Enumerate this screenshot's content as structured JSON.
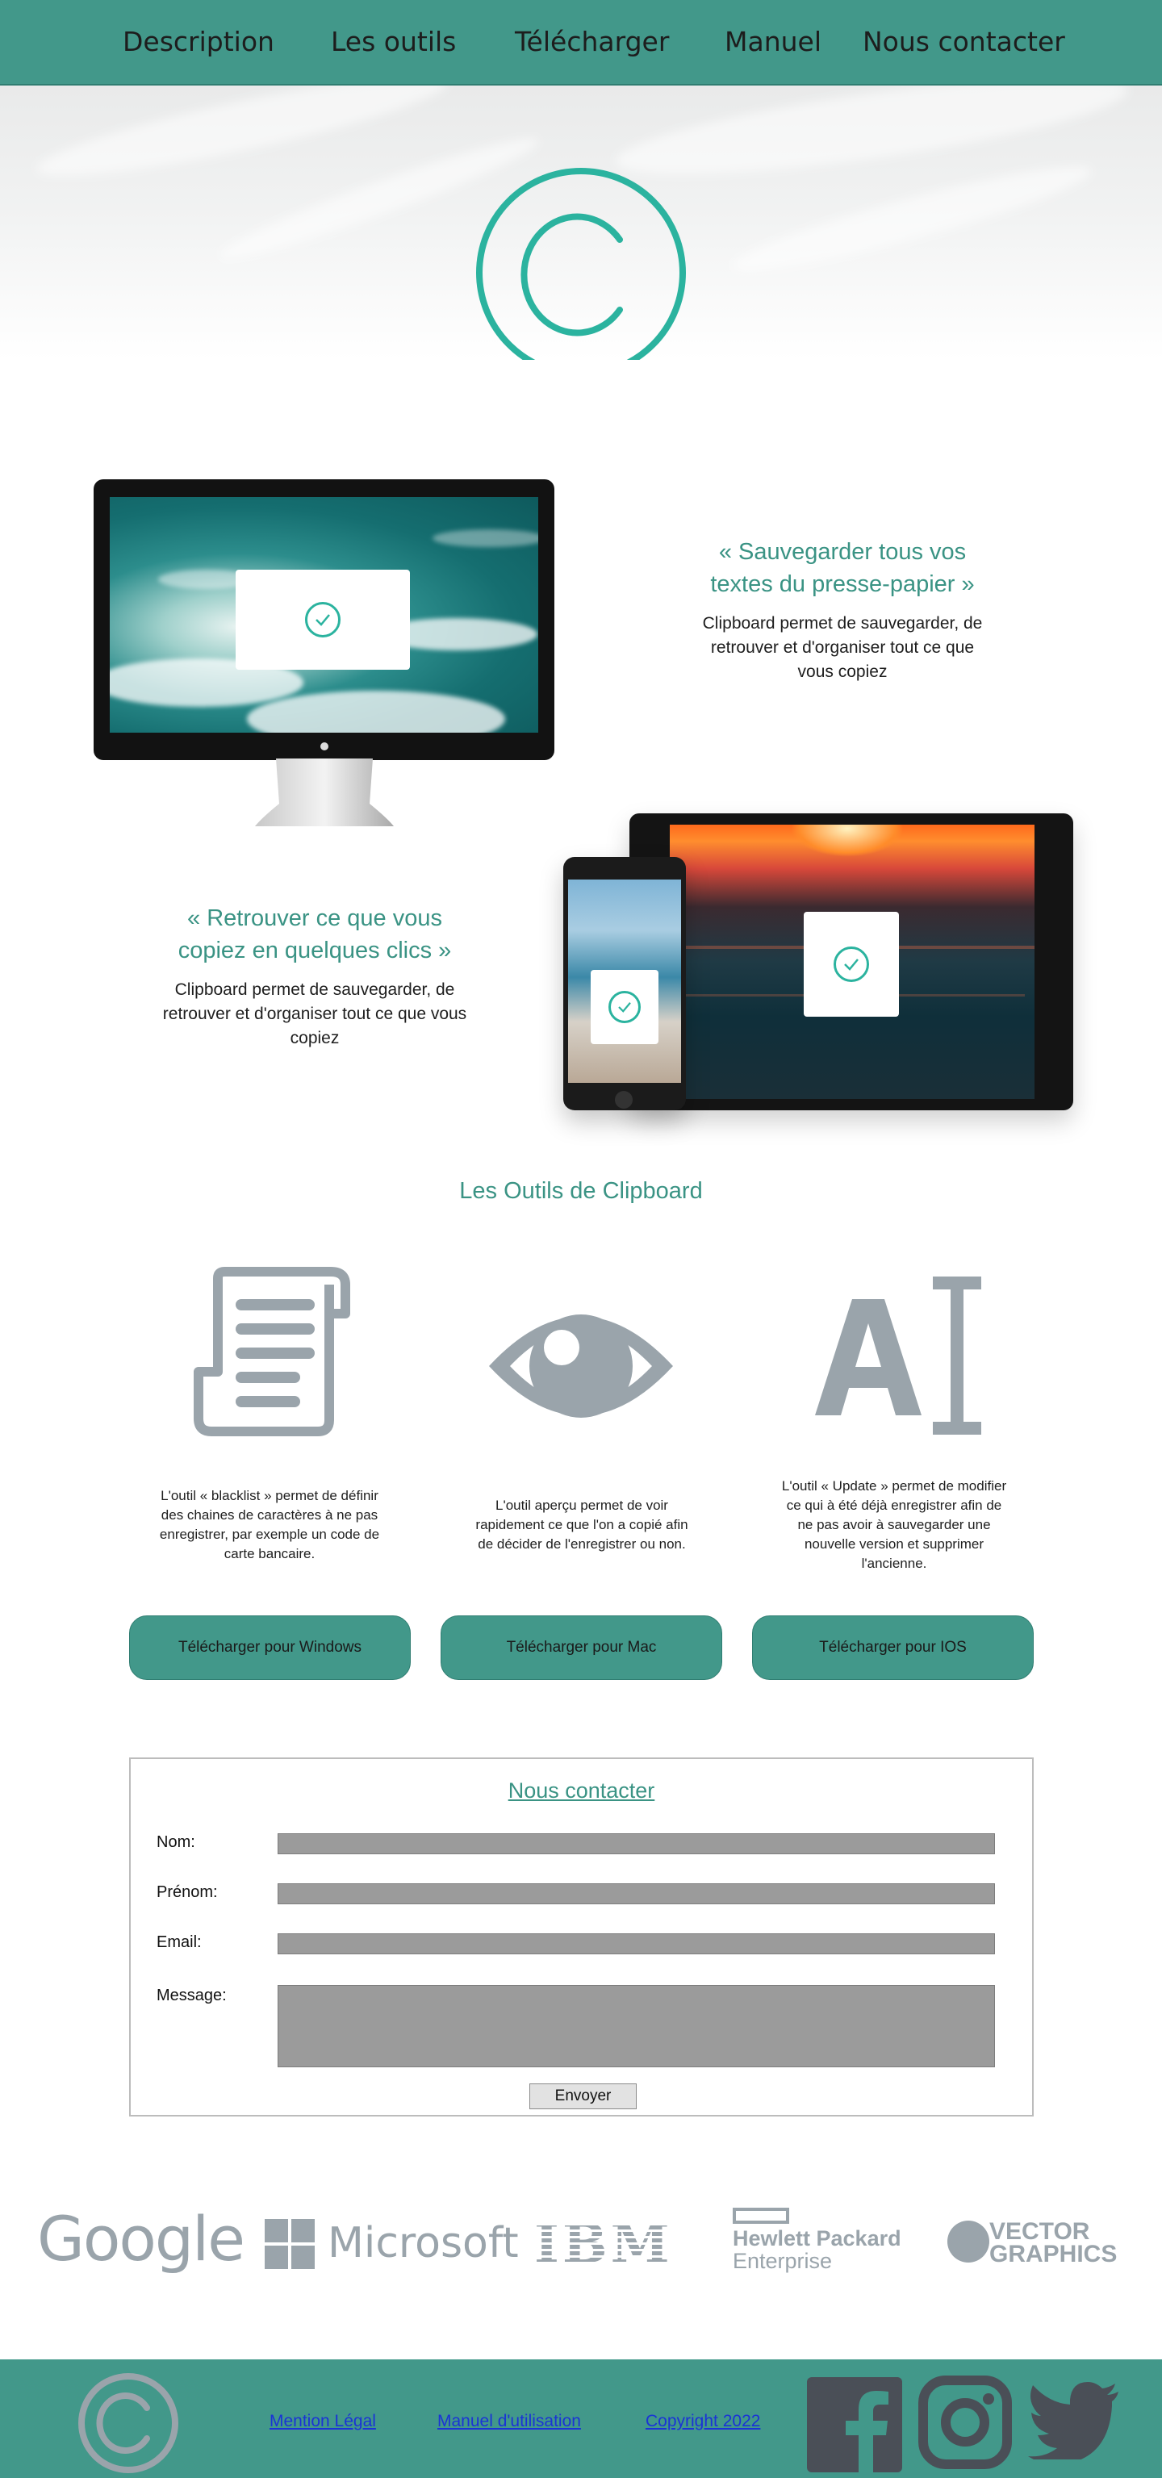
{
  "nav": {
    "items": [
      {
        "label": "Description"
      },
      {
        "label": "Les outils"
      },
      {
        "label": "Télécharger"
      },
      {
        "label": "Manuel"
      },
      {
        "label": "Nous contacter"
      }
    ]
  },
  "features": [
    {
      "title": "« Sauvegarder tous vos textes du presse-papier »",
      "text": "Clipboard permet de sauvegarder, de retrouver et d'organiser tout ce que vous copiez"
    },
    {
      "title": "« Retrouver ce que vous copiez en quelques clics »",
      "text": "Clipboard permet de sauvegarder, de retrouver et d'organiser tout ce que vous copiez"
    }
  ],
  "tools": {
    "title": "Les Outils de Clipboard",
    "items": [
      {
        "icon": "scroll-list-icon",
        "text": "L'outil « blacklist » permet de définir des chaines de caractères à ne pas enregistrer, par exemple un code de carte bancaire."
      },
      {
        "icon": "eye-icon",
        "text": "L'outil aperçu permet de voir rapidement ce que l'on a copié afin de décider de l'enregistrer ou non."
      },
      {
        "icon": "text-cursor-icon",
        "text": "L'outil « Update » permet de modifier ce qui à été déjà enregistrer afin de ne pas avoir à sauvegarder une nouvelle version et supprimer l'ancienne."
      }
    ],
    "downloads": [
      {
        "label": "Télécharger pour Windows"
      },
      {
        "label": "Télécharger pour Mac"
      },
      {
        "label": "Télécharger pour IOS"
      }
    ]
  },
  "contact": {
    "title": "Nous contacter",
    "fields": [
      {
        "label": "Nom:"
      },
      {
        "label": "Prénom:"
      },
      {
        "label": "Email:"
      },
      {
        "label": "Message:"
      }
    ],
    "submit": "Envoyer"
  },
  "partners": {
    "google": "Google",
    "microsoft": "Microsoft",
    "ibm": "IBM",
    "hp_line1": "Hewlett Packard",
    "hp_line2": "Enterprise",
    "vector_line1": "VECTOR",
    "vector_line2": "GRAPHICS"
  },
  "footer": {
    "links": [
      {
        "label": "Mention Légal"
      },
      {
        "label": "Manuel d'utilisation"
      },
      {
        "label": "Copyright 2022"
      }
    ],
    "social": [
      "facebook-icon",
      "instagram-icon",
      "twitter-icon"
    ]
  },
  "colors": {
    "accent": "#42988a",
    "accent_text": "#3a9384",
    "logo_teal": "#2bb39f",
    "icon_gray": "#9aa4ab",
    "footer_icon": "#4a4f57"
  }
}
